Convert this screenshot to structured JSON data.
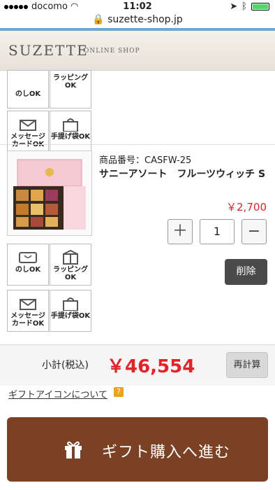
{
  "status_bar": {
    "carrier": "docomo",
    "time": "11:02"
  },
  "browser": {
    "url": "suzette-shop.jp"
  },
  "header": {
    "logo": "SUZETTE",
    "logo_sub": "ONLINE SHOP"
  },
  "top_gift_icons": [
    {
      "label": "のしOK",
      "icon": "noshi-icon"
    },
    {
      "label": "ラッピングOK",
      "icon": "gift-wrap-icon"
    },
    {
      "label": "メッセージカードOK",
      "icon": "message-card-icon"
    },
    {
      "label": "手提げ袋OK",
      "icon": "shopping-bag-icon"
    }
  ],
  "product": {
    "code": "商品番号：CASFW-25",
    "name": "サニーアソート　フルーツウィッチ S",
    "price": "￥2,700",
    "quantity": "1",
    "plus": "＋",
    "minus": "−",
    "delete_label": "削除",
    "gift_icons": [
      {
        "label": "のしOK",
        "icon": "noshi-icon"
      },
      {
        "label": "ラッピングOK",
        "icon": "gift-wrap-icon"
      },
      {
        "label": "メッセージカードOK",
        "icon": "message-card-icon"
      },
      {
        "label": "手提げ袋OK",
        "icon": "shopping-bag-icon"
      }
    ]
  },
  "subtotal": {
    "label": "小計(税込)",
    "value": "￥46,554",
    "recalc_label": "再計算"
  },
  "gift_info": {
    "link": "ギフトアイコンについて",
    "help": "?"
  },
  "cta": {
    "label": "ギフト購入へ進む"
  },
  "colors": {
    "price": "#e0242b",
    "cta_bg": "#7b4124",
    "accent_bar": "#6ea7d6"
  }
}
